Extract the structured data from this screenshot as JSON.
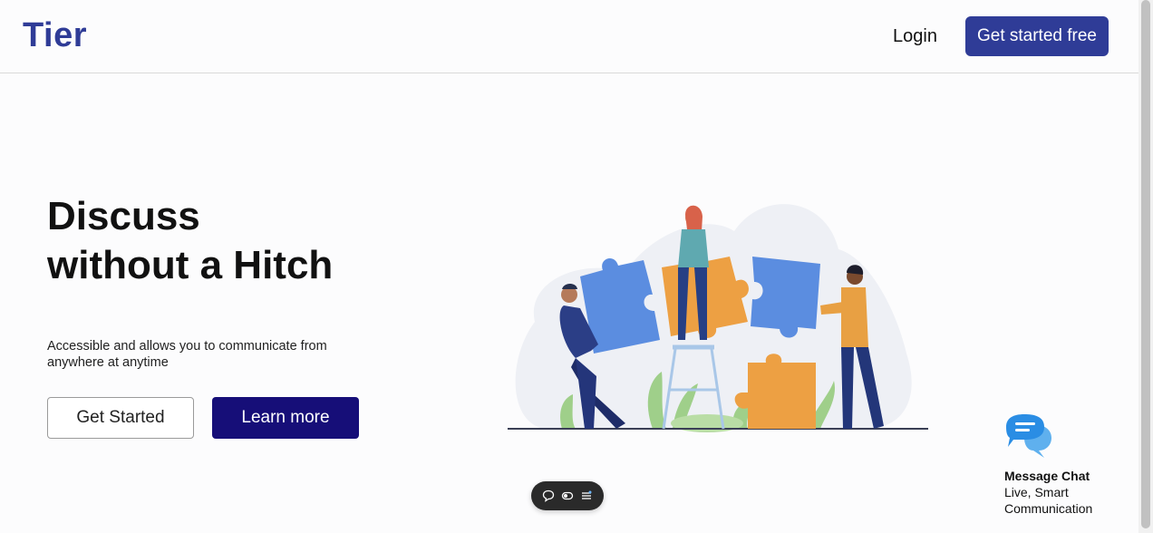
{
  "header": {
    "logo": "Tier",
    "login_label": "Login",
    "cta_label": "Get started free"
  },
  "hero": {
    "headline": "Discuss without a Hitch",
    "subtitle": "Accessible and allows you to communicate from anywhere at anytime",
    "primary_button": "Get Started",
    "secondary_button": "Learn more"
  },
  "chat_widget": {
    "title": "Message Chat",
    "subtitle": "Live, Smart Communication",
    "icon": "chat-bubbles-icon"
  },
  "toolbar": {
    "icons": [
      "comment-icon",
      "toggle-icon",
      "menu-icon"
    ]
  },
  "colors": {
    "brand": "#2f3c97",
    "secondary_button": "#160e78",
    "puzzle_blue": "#5b8de0",
    "puzzle_orange": "#eda043",
    "chat_blue": "#2a8de4"
  }
}
